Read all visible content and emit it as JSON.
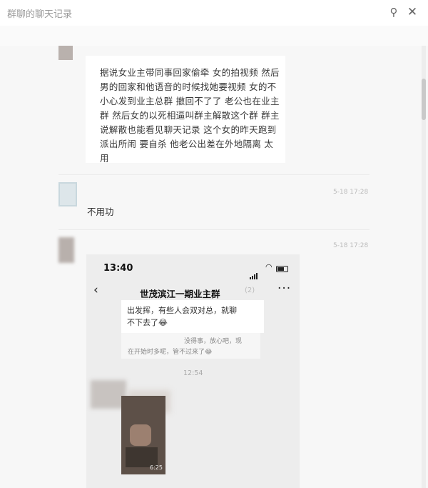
{
  "window": {
    "title": "群聊的聊天记录"
  },
  "messages": [
    {
      "text": "据说女业主带同事回家偷牵 女的拍视频 然后男的回家和他语音的时候找她要视频 女的不小心发到业主总群 撤回不了了 老公也在业主群 然后女的以死相逼叫群主解散这个群 群主说解散也能看见聊天记录 这个女的昨天跑到派出所闹 要自杀 他老公出差在外地隔离 太用"
    },
    {
      "time": "5-18 17:28",
      "text": "不用功"
    },
    {
      "time": "5-18 17:28"
    }
  ],
  "screenshot": {
    "status_time": "13:40",
    "group_name": "世茂滨江一期业主群",
    "muted_label": "(2)",
    "bubble1_line1": "出发挥，有些人会双对总，就聊",
    "bubble1_line2": "不下去了😂",
    "bubble2_line1": "没得事，放心吧，现",
    "bubble2_line2": "在开始时多呢，管不过来了😂",
    "chat_time": "12:54",
    "video_duration": "6:25"
  }
}
